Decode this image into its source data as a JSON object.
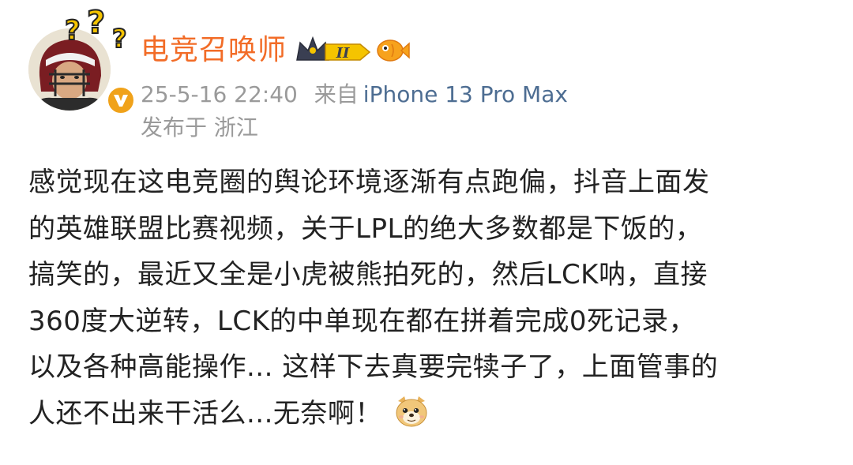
{
  "post": {
    "username": "电竞召唤师",
    "timestamp": "25-5-16 22:40",
    "source_prefix": "来自",
    "source_device": "iPhone 13 Pro Max",
    "location": "发布于 浙江",
    "badge_level": "II",
    "content_lines": [
      "感觉现在这电竞圈的舆论环境逐渐有点跑偏，抖音上面发",
      "的英雄联盟比赛视频，关于LPL的绝大多数都是下饭的，",
      "搞笑的，最近又全是小虎被熊拍死的，然后LCK呐，直接",
      "360度大逆转，LCK的中单现在都在拼着完成0死记录，",
      "以及各种高能操作... 这样下去真要完犊子了，上面管事的",
      "人还不出来干活么...无奈啊！"
    ],
    "emoji": "doge-icon"
  },
  "colors": {
    "username": "#f26c27",
    "meta": "#9a9a9a",
    "source_link": "#4d6d92",
    "text": "#222222",
    "verified": "#f0a21a"
  }
}
